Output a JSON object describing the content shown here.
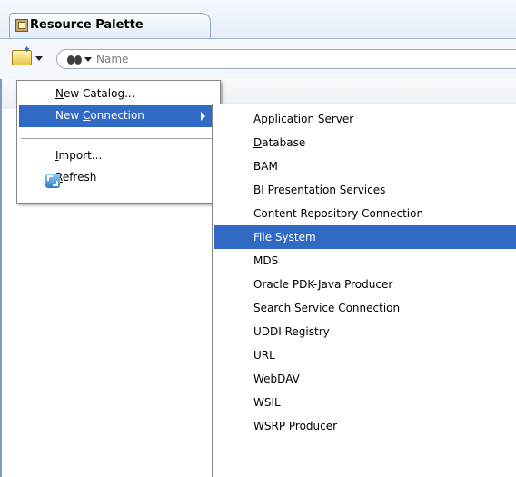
{
  "panel": {
    "title": "Resource Palette"
  },
  "search": {
    "placeholder": "Name"
  },
  "context_menu": {
    "items": [
      {
        "pre": "",
        "mn": "N",
        "post": "ew Catalog..."
      },
      {
        "pre": "New ",
        "mn": "C",
        "post": "onnection"
      },
      {
        "pre": "",
        "mn": "I",
        "post": "mport..."
      },
      {
        "pre": "",
        "mn": "R",
        "post": "efresh"
      }
    ],
    "selected": "New Connection"
  },
  "submenu": {
    "items": [
      {
        "pre": "",
        "mn": "A",
        "post": "pplication Server"
      },
      {
        "pre": "",
        "mn": "D",
        "post": "atabase"
      },
      {
        "pre": "BAM",
        "mn": "",
        "post": ""
      },
      {
        "pre": "BI Presentation Services",
        "mn": "",
        "post": ""
      },
      {
        "pre": "Content Repository Connection",
        "mn": "",
        "post": ""
      },
      {
        "pre": "File System",
        "mn": "",
        "post": ""
      },
      {
        "pre": "MDS",
        "mn": "",
        "post": ""
      },
      {
        "pre": "Oracle PDK-Java Producer",
        "mn": "",
        "post": ""
      },
      {
        "pre": "Search Service Connection",
        "mn": "",
        "post": ""
      },
      {
        "pre": "UDDI Registry",
        "mn": "",
        "post": ""
      },
      {
        "pre": "URL",
        "mn": "",
        "post": ""
      },
      {
        "pre": "WebDAV",
        "mn": "",
        "post": ""
      },
      {
        "pre": "WSIL",
        "mn": "",
        "post": ""
      },
      {
        "pre": "WSRP Producer",
        "mn": "",
        "post": ""
      }
    ],
    "selected": "File System"
  },
  "icons": {
    "tab": "resource-palette-icon",
    "new": "new-folder-star-icon",
    "search": "binoculars-icon",
    "refresh": "refresh-icon"
  },
  "colors": {
    "selection": "#316ac5",
    "tab_border": "#8fa9c9"
  }
}
